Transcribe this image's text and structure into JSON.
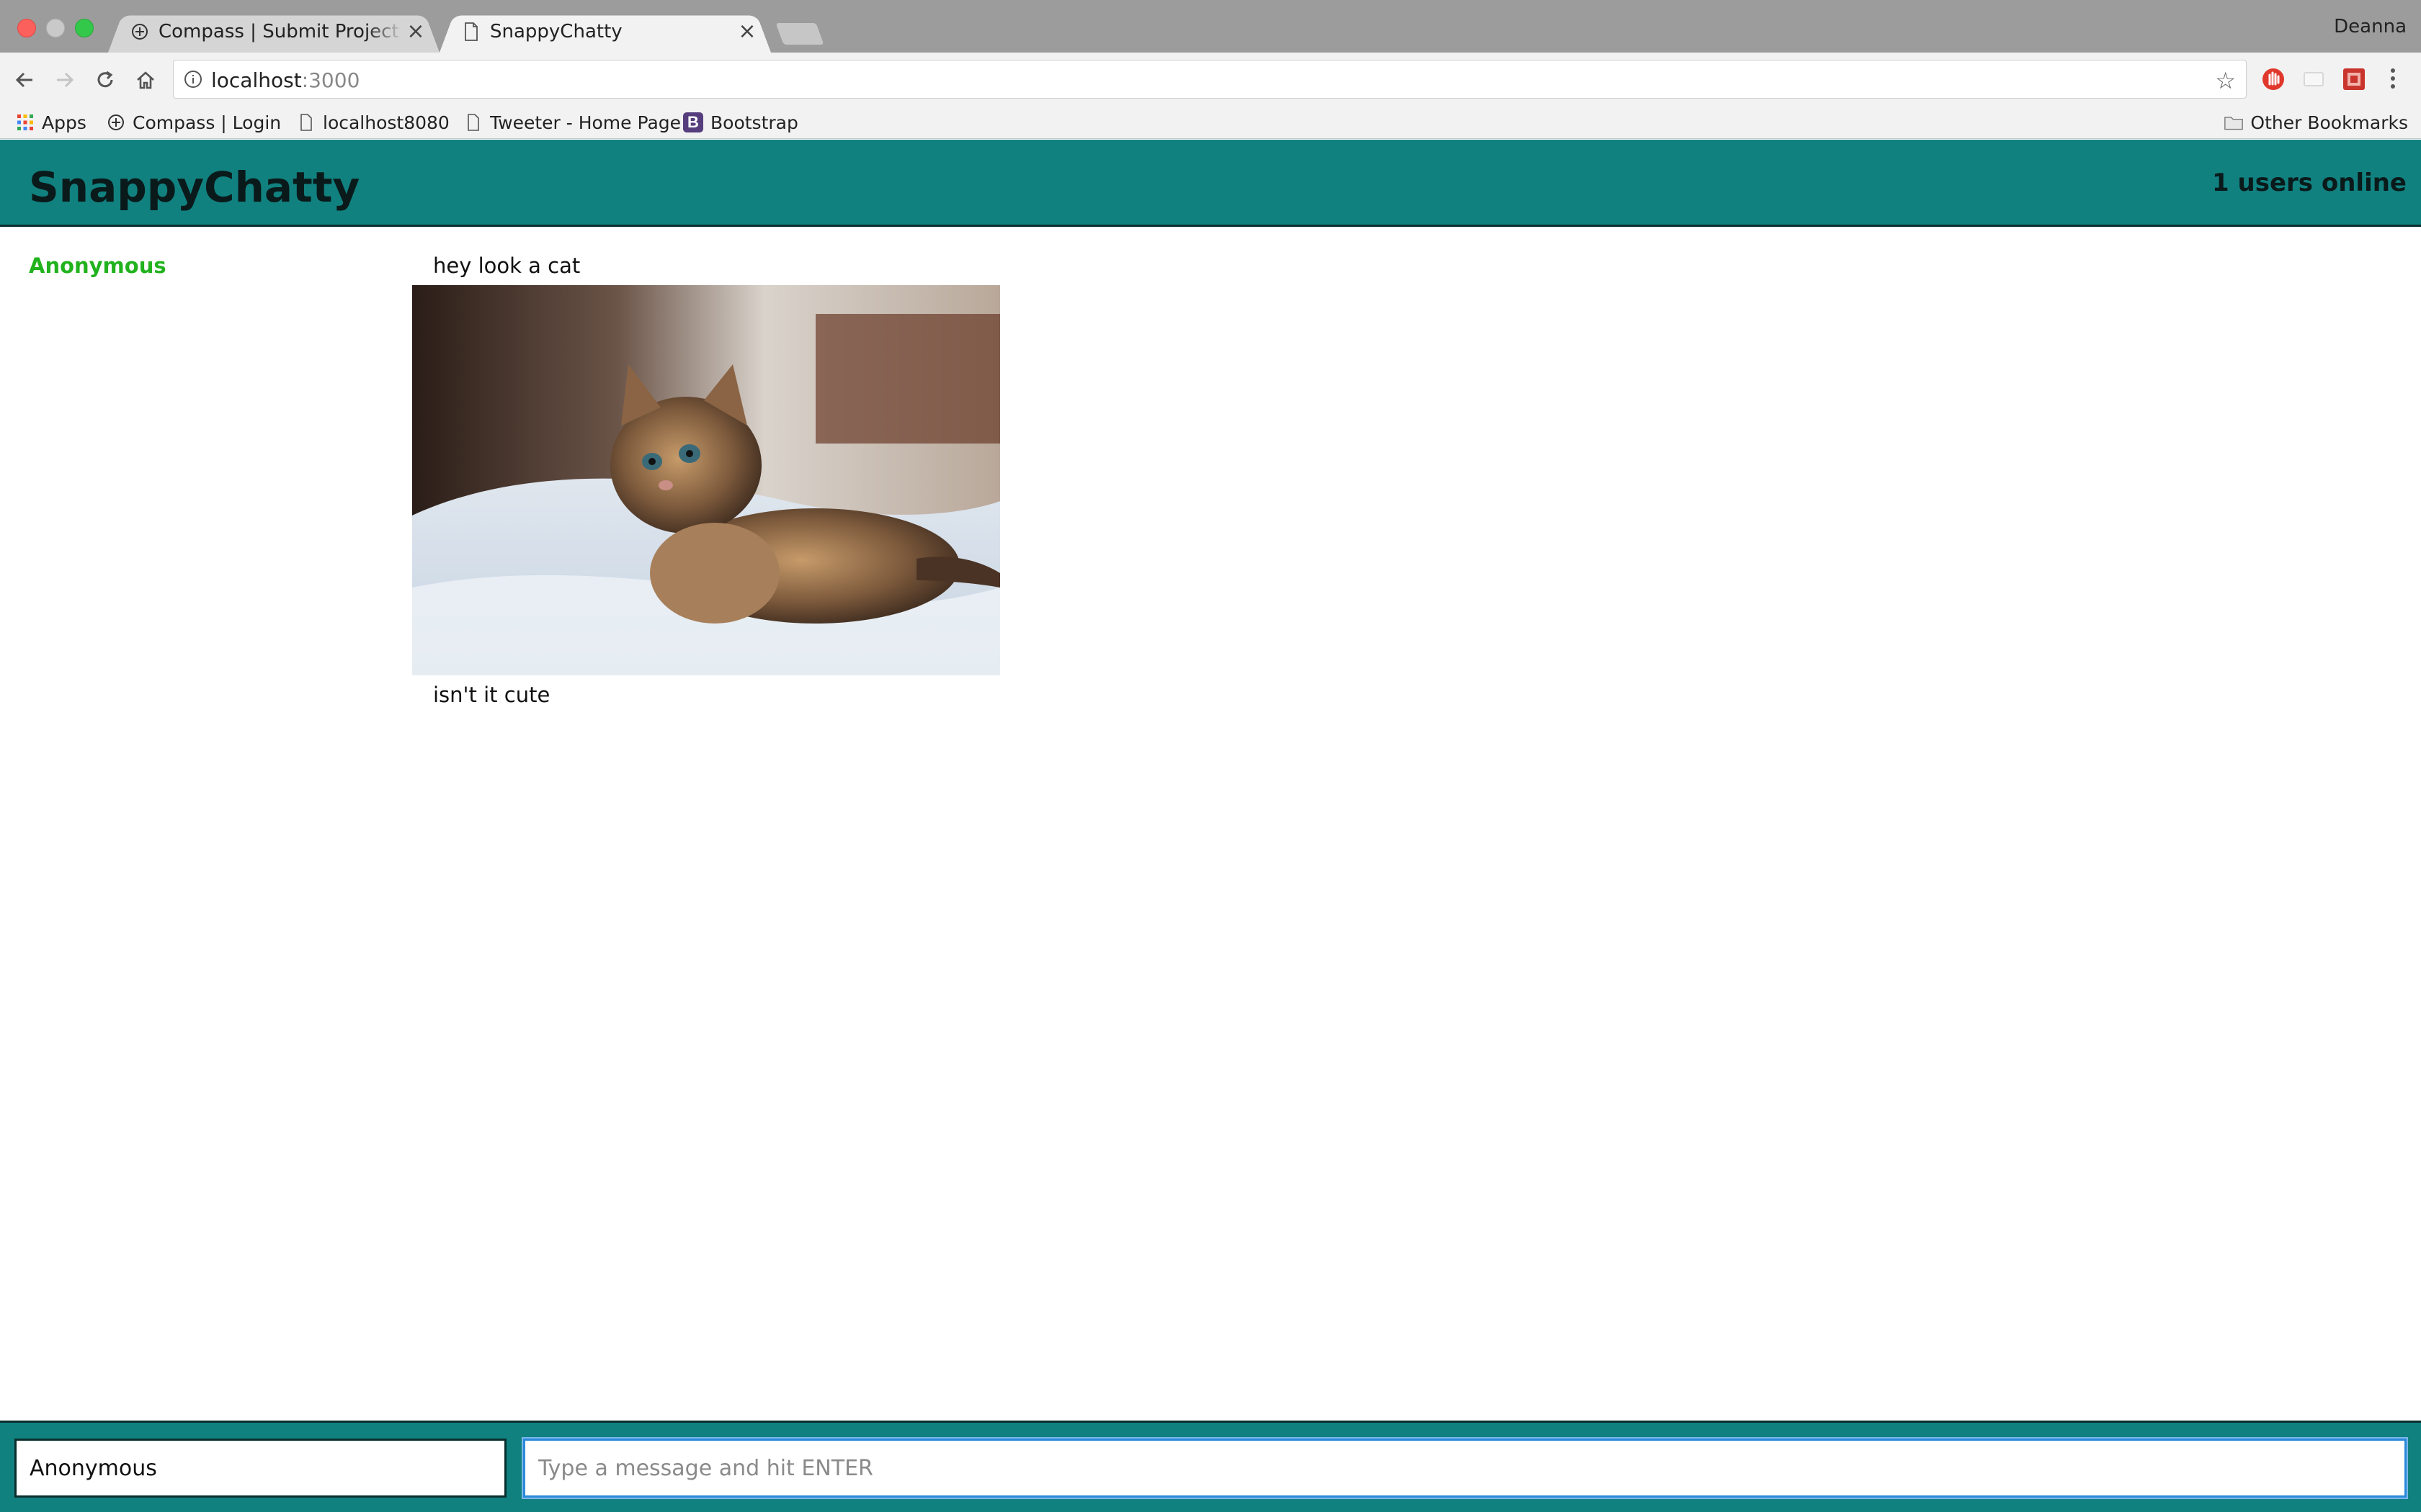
{
  "browser": {
    "tabs": [
      {
        "title": "Compass | Submit Project for E"
      },
      {
        "title": "SnappyChatty"
      }
    ],
    "profile_name": "Deanna",
    "address": {
      "host": "localhost",
      "port": ":3000"
    },
    "bookmarks": [
      {
        "label": "Apps",
        "icon": "apps-grid-icon"
      },
      {
        "label": "Compass | Login",
        "icon": "compass-icon"
      },
      {
        "label": "localhost8080",
        "icon": "page-icon"
      },
      {
        "label": "Tweeter - Home Page",
        "icon": "page-icon"
      },
      {
        "label": "Bootstrap",
        "icon": "bootstrap-icon"
      }
    ],
    "other_bookmarks": "Other Bookmarks",
    "colors": {
      "tabstrip": "#9c9c9c",
      "toolbar": "#f2f2f2"
    }
  },
  "app": {
    "brand": "SnappyChatty",
    "users_online": "1 users online",
    "colors": {
      "navbar": "#118180",
      "username": "#21b21e"
    },
    "messages": [
      {
        "username": "Anonymous",
        "lines": [
          "hey look a cat",
          "isn't it cute"
        ],
        "image": "kitten-photo"
      }
    ],
    "chatbar": {
      "username_value": "Anonymous",
      "message_placeholder": "Type a message and hit ENTER"
    }
  }
}
